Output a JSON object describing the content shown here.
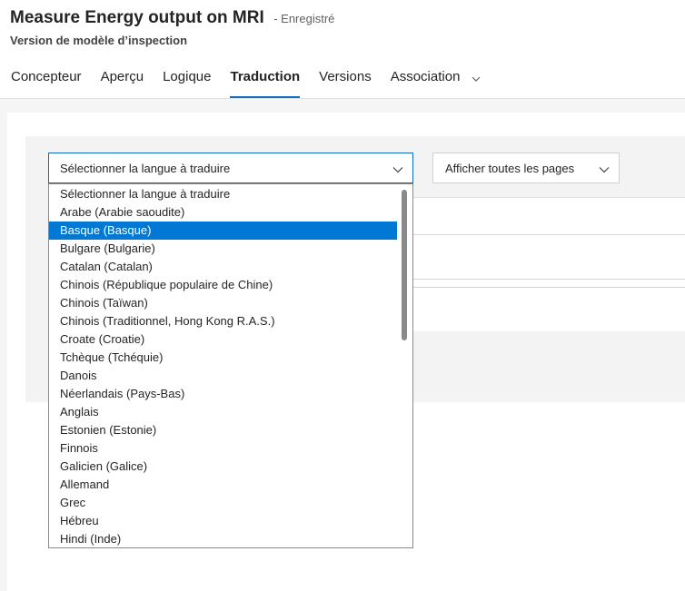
{
  "header": {
    "title": "Measure Energy output on MRI",
    "status": "- Enregistré",
    "subtitle": "Version de modèle d’inspection"
  },
  "tabs": [
    {
      "label": "Concepteur"
    },
    {
      "label": "Aperçu"
    },
    {
      "label": "Logique"
    },
    {
      "label": "Traduction",
      "active": true
    },
    {
      "label": "Versions"
    },
    {
      "label": "Association",
      "has_dropdown": true
    }
  ],
  "language_select": {
    "value": "Sélectionner la langue à traduire",
    "icon": "chevron-down-icon",
    "options": [
      "Sélectionner la langue à traduire",
      "Arabe (Arabie saoudite)",
      "Basque (Basque)",
      "Bulgare (Bulgarie)",
      "Catalan (Catalan)",
      "Chinois (République populaire de Chine)",
      "Chinois (Taïwan)",
      "Chinois (Traditionnel, Hong Kong R.A.S.)",
      "Croate (Croatie)",
      "Tchèque (Tchéquie)",
      "Danois",
      "Néerlandais (Pays-Bas)",
      "Anglais",
      "Estonien (Estonie)",
      "Finnois",
      "Galicien (Galice)",
      "Allemand",
      "Grec",
      "Hébreu",
      "Hindi (Inde)"
    ],
    "highlighted_option": "Basque (Basque)"
  },
  "pages_select": {
    "value": "Afficher toutes les pages",
    "icon": "chevron-down-icon"
  },
  "colors": {
    "accent": "#0f6cbd",
    "selected_option": "#0078d4"
  }
}
